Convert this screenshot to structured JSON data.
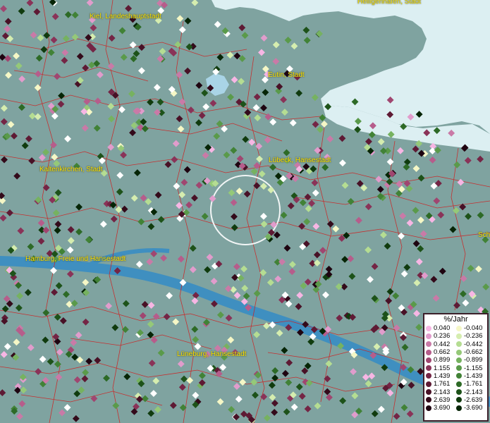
{
  "map": {
    "cities": [
      {
        "label": "Heiligenhafen, Stadt"
      },
      {
        "label": "Kiel, Landeshauptstadt"
      },
      {
        "label": "Eutin, Stadt"
      },
      {
        "label": "Lübeck, Hansestadt"
      },
      {
        "label": "Kaltenkirchen, Stadt"
      },
      {
        "label": "Hamburg, Freie und Hansestadt"
      },
      {
        "label": "Lüneburg, Hansestadt"
      },
      {
        "label": "Sch"
      }
    ],
    "colors": {
      "land": "#7fa3a0",
      "sea": "#dceff2",
      "river": "#3f8fc0",
      "boundary": "#d11d1d",
      "city_label": "#ffe600"
    }
  },
  "legend": {
    "title": "%/Jahr",
    "positive": [
      {
        "label": "0.040",
        "color": "#f7b6e4"
      },
      {
        "label": "0.236",
        "color": "#e19ccc"
      },
      {
        "label": "0.442",
        "color": "#c97aa7"
      },
      {
        "label": "0.662",
        "color": "#b65d8b"
      },
      {
        "label": "0.899",
        "color": "#a04670"
      },
      {
        "label": "1.155",
        "color": "#8a3358"
      },
      {
        "label": "1.439",
        "color": "#742545"
      },
      {
        "label": "1.761",
        "color": "#5e1a34"
      },
      {
        "label": "2.143",
        "color": "#481126"
      },
      {
        "label": "2.639",
        "color": "#330a1a"
      },
      {
        "label": "3.690",
        "color": "#1e0410"
      }
    ],
    "negative": [
      {
        "label": "-0.040",
        "color": "#f5f7c6"
      },
      {
        "label": "-0.236",
        "color": "#d5edaf"
      },
      {
        "label": "-0.442",
        "color": "#b5dd92"
      },
      {
        "label": "-0.662",
        "color": "#95c978"
      },
      {
        "label": "-0.899",
        "color": "#76b260"
      },
      {
        "label": "-1.155",
        "color": "#5a9a4a"
      },
      {
        "label": "-1.439",
        "color": "#418236"
      },
      {
        "label": "-1.761",
        "color": "#2d6a26"
      },
      {
        "label": "-2.143",
        "color": "#1d5219"
      },
      {
        "label": "-2.639",
        "color": "#103b0e"
      },
      {
        "label": "-3.690",
        "color": "#062506"
      }
    ]
  }
}
